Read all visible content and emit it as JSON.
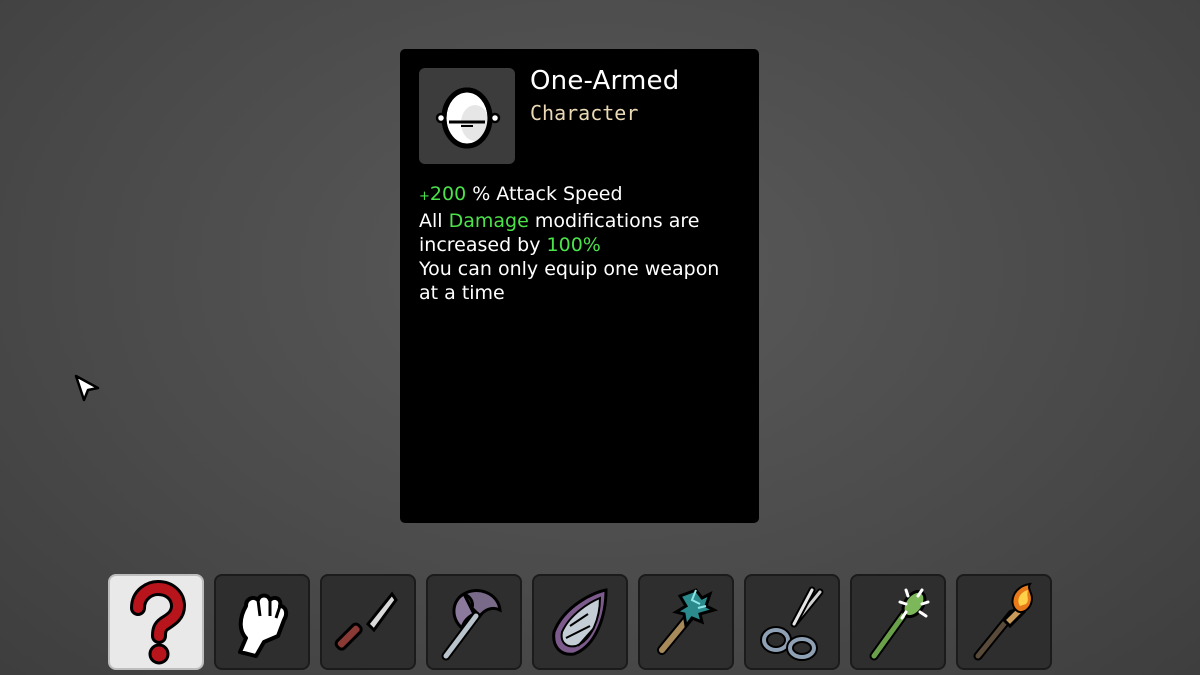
{
  "tooltip": {
    "name": "One-Armed",
    "type": "Character",
    "desc": {
      "line1_value": "200",
      "line1_plus": "+",
      "line1_text": " % Attack Speed",
      "line2_prefix": "All ",
      "line2_keyword": "Damage",
      "line2_suffix": " modifications are",
      "line3_prefix": "increased by ",
      "line3_value": "100%",
      "line4": "You can only equip one weapon",
      "line5": "at a time"
    }
  },
  "colors": {
    "highlight_green": "#4ce24a",
    "type_text": "#ead9b4",
    "panel_bg": "#000000",
    "slot_bg": "#2e2e2e",
    "selected_slot_bg": "#e9e9e9"
  },
  "weapon_slots": [
    {
      "icon": "random-question-mark-icon",
      "selected": true
    },
    {
      "icon": "fist-icon",
      "selected": false
    },
    {
      "icon": "knife-icon",
      "selected": false
    },
    {
      "icon": "axe-icon",
      "selected": false
    },
    {
      "icon": "crystal-shard-icon",
      "selected": false
    },
    {
      "icon": "lightning-hammer-icon",
      "selected": false
    },
    {
      "icon": "scissors-icon",
      "selected": false
    },
    {
      "icon": "spiked-mace-icon",
      "selected": false
    },
    {
      "icon": "torch-icon",
      "selected": false
    }
  ]
}
